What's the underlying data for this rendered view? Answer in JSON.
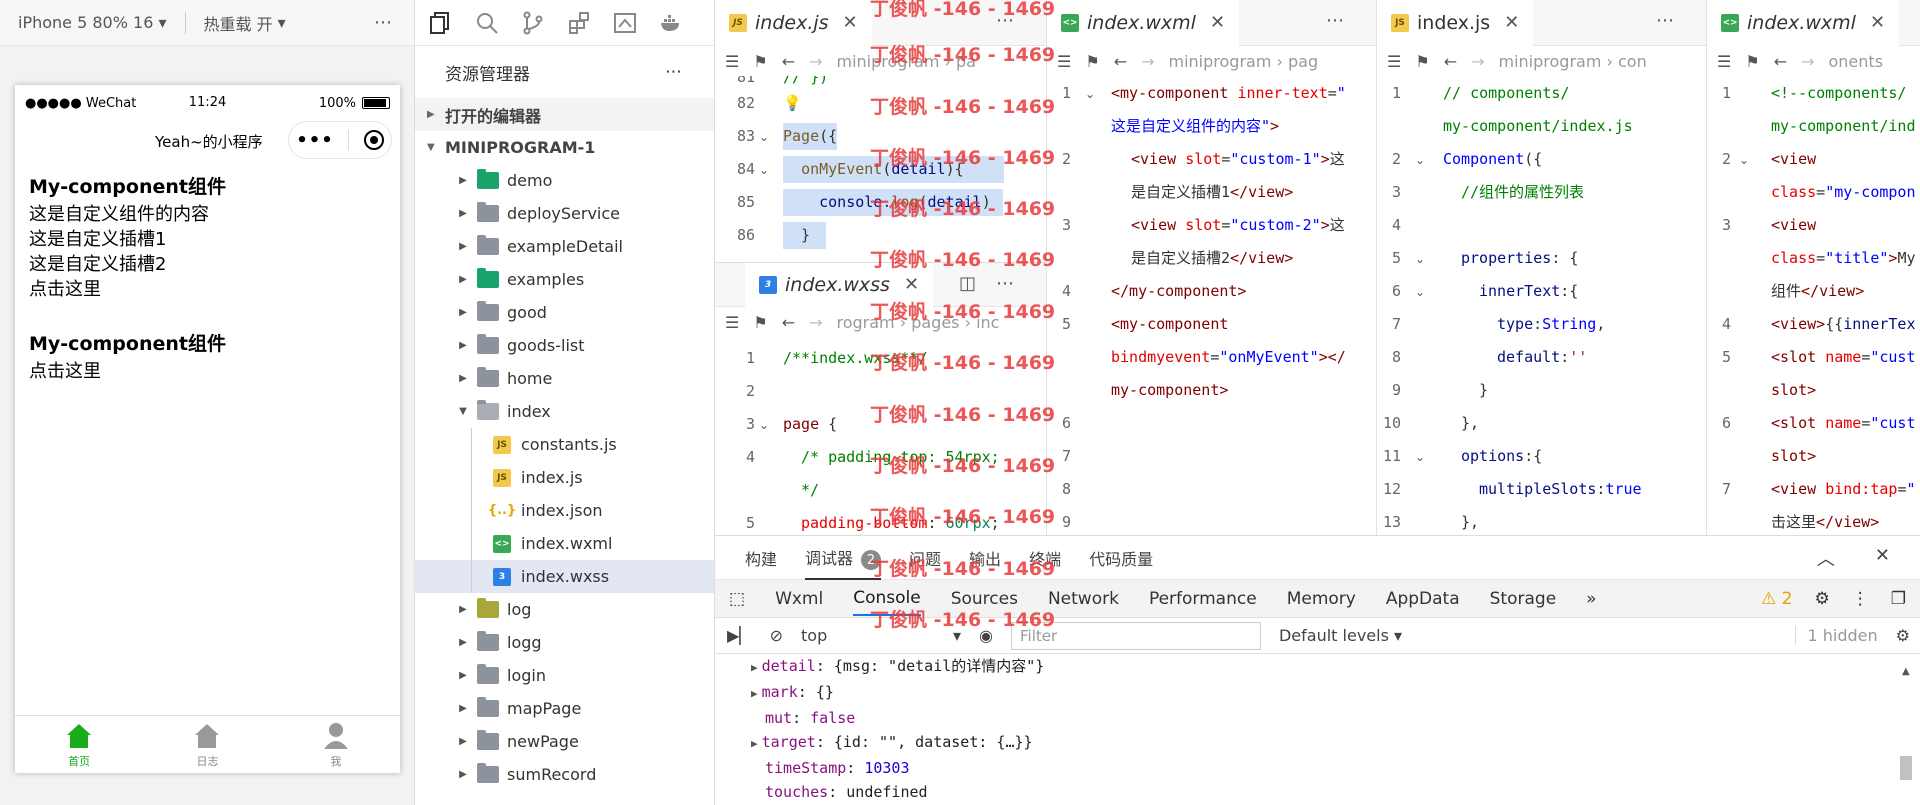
{
  "simulator": {
    "device": "iPhone 5 80% 16",
    "hot_reload": "热重载 开",
    "more": "⋯",
    "status": {
      "carrier": "●●●●● WeChat",
      "time": "11:24",
      "battery": "100%"
    },
    "nav_title": "Yeah~的小程序",
    "page": {
      "block1_title": "My-component组件",
      "block1_lines": [
        "这是自定义组件的内容",
        "这是自定义插槽1",
        "这是自定义插槽2",
        "点击这里"
      ],
      "block2_title": "My-component组件",
      "block2_line": "点击这里"
    },
    "tabs": [
      {
        "label": "首页",
        "icon": "home-icon"
      },
      {
        "label": "日志",
        "icon": "log-icon"
      },
      {
        "label": "我",
        "icon": "user-icon"
      }
    ]
  },
  "explorer": {
    "title": "资源管理器",
    "open_editors": "打开的编辑器",
    "project": "MINIPROGRAM-1",
    "items": [
      {
        "name": "demo",
        "type": "folder-green"
      },
      {
        "name": "deployService",
        "type": "folder"
      },
      {
        "name": "exampleDetail",
        "type": "folder"
      },
      {
        "name": "examples",
        "type": "folder-green"
      },
      {
        "name": "good",
        "type": "folder"
      },
      {
        "name": "goods-list",
        "type": "folder"
      },
      {
        "name": "home",
        "type": "folder"
      },
      {
        "name": "index",
        "type": "folder-open"
      },
      {
        "name": "constants.js",
        "type": "js"
      },
      {
        "name": "index.js",
        "type": "js"
      },
      {
        "name": "index.json",
        "type": "json"
      },
      {
        "name": "index.wxml",
        "type": "wxml"
      },
      {
        "name": "index.wxss",
        "type": "wxss"
      },
      {
        "name": "log",
        "type": "folder-yellow"
      },
      {
        "name": "logg",
        "type": "folder"
      },
      {
        "name": "login",
        "type": "folder"
      },
      {
        "name": "mapPage",
        "type": "folder"
      },
      {
        "name": "newPage",
        "type": "folder"
      },
      {
        "name": "sumRecord",
        "type": "folder"
      }
    ]
  },
  "editors": {
    "tab1": "index.js",
    "tab2": "index.wxml",
    "tab3": "index.js",
    "tab4": "index.wxml",
    "tab_wxss": "index.wxss",
    "crumb1": "miniprogram › pa",
    "crumb2": "miniprogram › pag",
    "crumb3": "miniprogram › con",
    "crumb4": "onents",
    "crumb_wxss": "rogram › pages › inc"
  },
  "watermark": "丁俊帆 -146 - 1469",
  "panel": {
    "tabs": [
      "构建",
      "调试器",
      "问题",
      "输出",
      "终端",
      "代码质量"
    ],
    "debugger_badge": "2",
    "devtools_tabs": [
      "Wxml",
      "Console",
      "Sources",
      "Network",
      "Performance",
      "Memory",
      "AppData",
      "Storage"
    ],
    "warn_count": "2",
    "context": "top",
    "filter_placeholder": "Filter",
    "levels": "Default levels",
    "hidden": "1 hidden"
  },
  "console_lines": [
    {
      "key": "detail",
      "val": "{msg: \"detail的详情内容\"}"
    },
    {
      "key": "mark",
      "val": "{}"
    },
    {
      "key": "mut",
      "val": "false"
    },
    {
      "key": "target",
      "val": "{id: \"\", dataset: {…}}"
    },
    {
      "key": "timeStamp",
      "val": "10303"
    },
    {
      "key": "touches",
      "val": "undefined"
    }
  ]
}
